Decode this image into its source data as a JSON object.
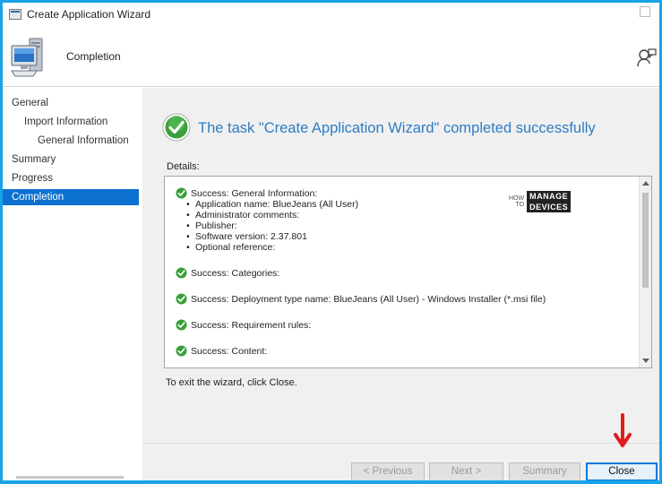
{
  "window": {
    "title": "Create Application Wizard"
  },
  "header": {
    "page_title": "Completion"
  },
  "nav": {
    "items": [
      {
        "label": "General",
        "indent": 0,
        "active": false
      },
      {
        "label": "Import Information",
        "indent": 1,
        "active": false
      },
      {
        "label": "General Information",
        "indent": 2,
        "active": false
      },
      {
        "label": "Summary",
        "indent": 0,
        "active": false
      },
      {
        "label": "Progress",
        "indent": 0,
        "active": false
      },
      {
        "label": "Completion",
        "indent": 0,
        "active": true
      }
    ]
  },
  "main": {
    "headline": "The task \"Create Application Wizard\" completed successfully",
    "details_label": "Details:",
    "exit_hint": "To exit the wizard, click Close."
  },
  "details": {
    "blocks": [
      {
        "heading": "Success: General Information:",
        "bullets": [
          "Application name: BlueJeans (All User)",
          "Administrator comments:",
          "Publisher:",
          "Software version: 2.37.801",
          "Optional reference:"
        ]
      },
      {
        "heading": "Success: Categories:",
        "bullets": []
      },
      {
        "heading": "Success: Deployment type name: BlueJeans (All User) - Windows Installer (*.msi file)",
        "bullets": []
      },
      {
        "heading": "Success: Requirement rules:",
        "bullets": []
      },
      {
        "heading": "Success: Content:",
        "bullets": []
      }
    ]
  },
  "watermark": {
    "line1": "HOW",
    "line2": "TO",
    "badge1": "MANAGE",
    "badge2": "DEVICES"
  },
  "footer": {
    "previous_label": "< Previous",
    "next_label": "Next >",
    "summary_label": "Summary",
    "close_label": "Close"
  },
  "colors": {
    "accent": "#0d71d1",
    "headline": "#2e7cc4",
    "success_green": "#3aa03a",
    "annotation_arrow": "#e01b1b",
    "frame": "#1aa3e8"
  },
  "icons": {
    "window": "app-window-icon",
    "header": "computer-icon",
    "feedback": "feedback-icon",
    "status": "success-check-icon",
    "annotation": "red-down-arrow-icon"
  }
}
